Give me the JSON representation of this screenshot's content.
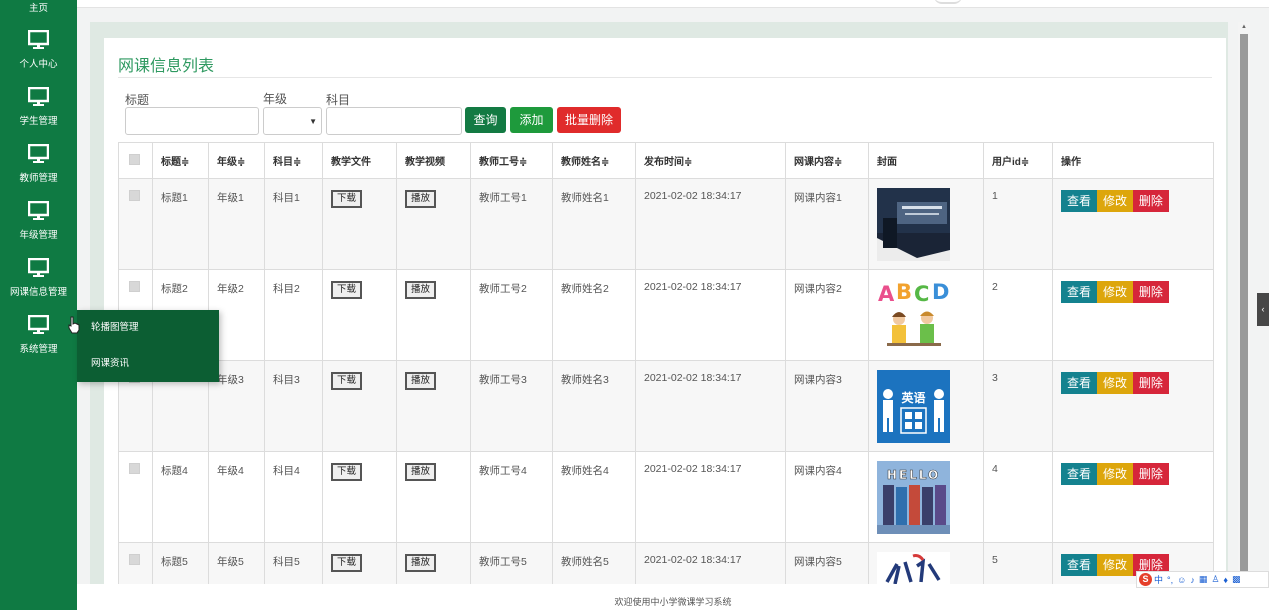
{
  "sidebar": {
    "items": [
      {
        "label": "主页"
      },
      {
        "label": "个人中心"
      },
      {
        "label": "学生管理"
      },
      {
        "label": "教师管理"
      },
      {
        "label": "年级管理"
      },
      {
        "label": "网课信息管理"
      },
      {
        "label": "系统管理"
      }
    ],
    "submenu": [
      {
        "label": "轮播图管理"
      },
      {
        "label": "网课资讯"
      }
    ]
  },
  "page": {
    "title": "网课信息列表",
    "filters": {
      "title_label": "标题",
      "grade_label": "年级",
      "subject_label": "科目"
    },
    "buttons": {
      "query": "查询",
      "add": "添加",
      "batch_delete": "批量删除"
    }
  },
  "table": {
    "headers": [
      "标题≑",
      "年级≑",
      "科目≑",
      "教学文件",
      "教学视频",
      "教师工号≑",
      "教师姓名≑",
      "发布时间≑",
      "网课内容≑",
      "封面",
      "用户id≑",
      "操作"
    ],
    "download_label": "下载",
    "play_label": "播放",
    "actions": {
      "view": "查看",
      "edit": "修改",
      "delete": "删除"
    },
    "rows": [
      {
        "title": "标题1",
        "grade": "年级1",
        "subject": "科目1",
        "teacher_id": "教师工号1",
        "teacher_name": "教师姓名1",
        "time": "2021-02-02 18:34:17",
        "content": "网课内容1",
        "user_id": "1"
      },
      {
        "title": "标题2",
        "grade": "年级2",
        "subject": "科目2",
        "teacher_id": "教师工号2",
        "teacher_name": "教师姓名2",
        "time": "2021-02-02 18:34:17",
        "content": "网课内容2",
        "user_id": "2"
      },
      {
        "title": "",
        "grade": "年级3",
        "subject": "科目3",
        "teacher_id": "教师工号3",
        "teacher_name": "教师姓名3",
        "time": "2021-02-02 18:34:17",
        "content": "网课内容3",
        "user_id": "3"
      },
      {
        "title": "标题4",
        "grade": "年级4",
        "subject": "科目4",
        "teacher_id": "教师工号4",
        "teacher_name": "教师姓名4",
        "time": "2021-02-02 18:34:17",
        "content": "网课内容4",
        "user_id": "4"
      },
      {
        "title": "标题5",
        "grade": "年级5",
        "subject": "科目5",
        "teacher_id": "教师工号5",
        "teacher_name": "教师姓名5",
        "time": "2021-02-02 18:34:17",
        "content": "网课内容5",
        "user_id": "5"
      }
    ]
  },
  "covers": {
    "cover2_letters": [
      "A",
      "B",
      "C",
      "D"
    ],
    "cover3_text": "英语",
    "cover4_text": "HELLO"
  },
  "footer": {
    "text": "欢迎使用中小学微课学习系统"
  },
  "ime": {
    "logo": "S",
    "mode": "中",
    "punct": "°,"
  },
  "colors": {
    "sidebar": "#0f7a43",
    "submenu": "#0c5e33",
    "title": "#2e9960",
    "query": "#137a43",
    "add": "#1e9a3c",
    "batch_delete": "#e02b2b",
    "view": "#14828f",
    "edit": "#dda60c",
    "delete": "#d6263a"
  }
}
